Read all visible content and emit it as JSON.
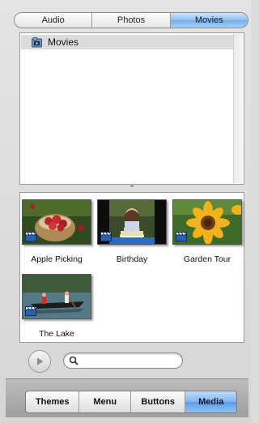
{
  "top_tabs": {
    "items": [
      {
        "label": "Audio"
      },
      {
        "label": "Photos"
      },
      {
        "label": "Movies"
      }
    ],
    "active": "Movies"
  },
  "browser": {
    "selected_source": "Movies",
    "source_icon": "movie-folder-icon"
  },
  "media": {
    "items": [
      {
        "title": "Apple Picking"
      },
      {
        "title": "Birthday"
      },
      {
        "title": "Garden Tour"
      },
      {
        "title": "The Lake"
      }
    ]
  },
  "search": {
    "value": "",
    "placeholder": ""
  },
  "bottom_tabs": {
    "items": [
      {
        "label": "Themes"
      },
      {
        "label": "Menu"
      },
      {
        "label": "Buttons"
      },
      {
        "label": "Media"
      }
    ],
    "active": "Media"
  },
  "colors": {
    "accent_blue": "#7fb5ee",
    "panel_bg": "#dcdcdc"
  }
}
